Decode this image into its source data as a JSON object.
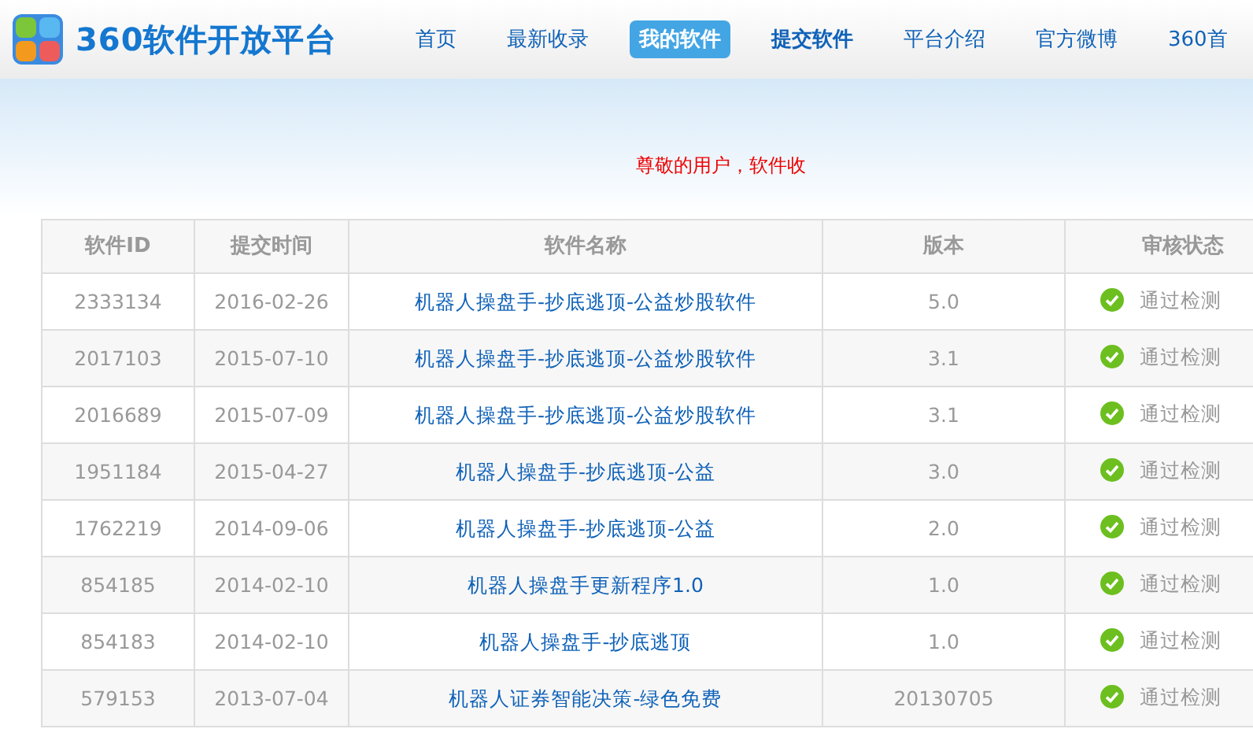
{
  "logo": {
    "text": "360软件开放平台"
  },
  "nav": [
    {
      "label": "首页",
      "selected": false,
      "bold": false
    },
    {
      "label": "最新收录",
      "selected": false,
      "bold": false
    },
    {
      "label": "我的软件",
      "selected": true,
      "bold": true
    },
    {
      "label": "提交软件",
      "selected": false,
      "bold": true
    },
    {
      "label": "平台介绍",
      "selected": false,
      "bold": false
    },
    {
      "label": "官方微博",
      "selected": false,
      "bold": false
    },
    {
      "label": "360首",
      "selected": false,
      "bold": false
    }
  ],
  "notice": "尊敬的用户，软件收",
  "table": {
    "columns": [
      "软件ID",
      "提交时间",
      "软件名称",
      "版本",
      "审核状态"
    ],
    "rows": [
      {
        "id": "2333134",
        "date": "2016-02-26",
        "name": "机器人操盘手-抄底逃顶-公益炒股软件",
        "version": "5.0",
        "status": "通过检测",
        "passed": true
      },
      {
        "id": "2017103",
        "date": "2015-07-10",
        "name": "机器人操盘手-抄底逃顶-公益炒股软件",
        "version": "3.1",
        "status": "通过检测",
        "passed": true
      },
      {
        "id": "2016689",
        "date": "2015-07-09",
        "name": "机器人操盘手-抄底逃顶-公益炒股软件",
        "version": "3.1",
        "status": "通过检测",
        "passed": true
      },
      {
        "id": "1951184",
        "date": "2015-04-27",
        "name": "机器人操盘手-抄底逃顶-公益",
        "version": "3.0",
        "status": "通过检测",
        "passed": true
      },
      {
        "id": "1762219",
        "date": "2014-09-06",
        "name": "机器人操盘手-抄底逃顶-公益",
        "version": "2.0",
        "status": "通过检测",
        "passed": true
      },
      {
        "id": "854185",
        "date": "2014-02-10",
        "name": "机器人操盘手更新程序1.0",
        "version": "1.0",
        "status": "通过检测",
        "passed": true
      },
      {
        "id": "854183",
        "date": "2014-02-10",
        "name": "机器人操盘手-抄底逃顶",
        "version": "1.0",
        "status": "通过检测",
        "passed": true
      },
      {
        "id": "579153",
        "date": "2013-07-04",
        "name": "机器人证券智能决策-绿色免费",
        "version": "20130705",
        "status": "通过检测",
        "passed": true
      }
    ]
  }
}
